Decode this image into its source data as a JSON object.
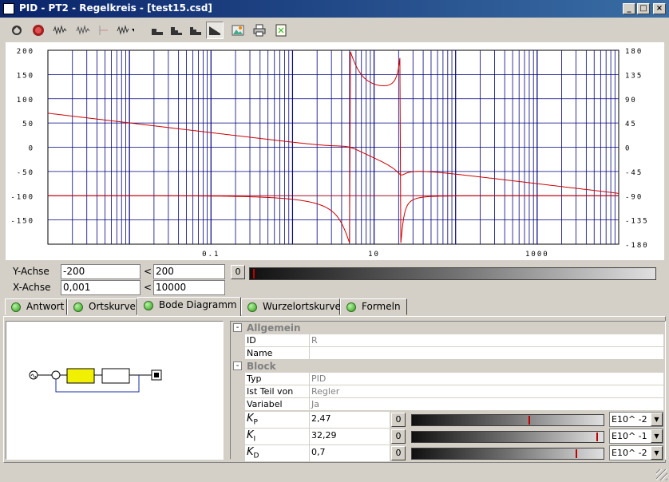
{
  "window": {
    "title": "PID - PT2 - Regelkreis - [test15.csd]",
    "min": "_",
    "max": "□",
    "close": "×"
  },
  "toolbar": {
    "icons": [
      "refresh-icon",
      "stop-icon",
      "noise-icon",
      "noise-plus-icon",
      "marker-icon",
      "noise-dropdown-icon",
      "step-response-icon",
      "step-response-2-icon",
      "step-response-3-icon",
      "bode-icon",
      "image-icon",
      "print-icon",
      "export-icon"
    ],
    "active": "bode-icon"
  },
  "plot": {
    "left_ticks": [
      "200",
      "150",
      "100",
      "50",
      "0",
      "-50",
      "-100",
      "-150"
    ],
    "right_ticks": [
      "180",
      "135",
      "90",
      "45",
      "0",
      "-45",
      "-90",
      "-135",
      "-180"
    ],
    "x_ticks": [
      "0.1",
      "10",
      "1000"
    ],
    "colors": {
      "curve": "#cc0000",
      "grid": "#000080"
    }
  },
  "axes": {
    "y_label": "Y-Achse",
    "y_min": "-200",
    "y_lt": "<",
    "y_max": "200",
    "x_label": "X-Achse",
    "x_min": "0,001",
    "x_lt": "<",
    "x_max": "10000",
    "zoom_btn": "0"
  },
  "tabs": [
    {
      "label": "Antwort"
    },
    {
      "label": "Ortskurve"
    },
    {
      "label": "Bode Diagramm"
    },
    {
      "label": "Wurzelortskurve"
    },
    {
      "label": "Formeln"
    }
  ],
  "props": {
    "general": {
      "header": "Allgemein",
      "pm": "-",
      "id_label": "ID",
      "id_value": "R",
      "name_label": "Name",
      "name_value": ""
    },
    "block": {
      "header": "Block",
      "pm": "-",
      "typ_label": "Typ",
      "typ_value": "PID",
      "teil_label": "Ist Teil von",
      "teil_value": "Regler",
      "var_label": "Variabel",
      "var_value": "Ja"
    },
    "kp": {
      "sym": "K",
      "sub": "P",
      "value": "2,47",
      "btn": "0",
      "scale": "E10^ -2",
      "level": 0.62
    },
    "ki": {
      "sym": "K",
      "sub": "I",
      "value": "32,29",
      "btn": "0",
      "scale": "E10^ -1",
      "level": 0.98
    },
    "kd": {
      "sym": "K",
      "sub": "D",
      "value": "0,7",
      "btn": "0",
      "scale": "E10^ -2",
      "level": 0.87
    }
  }
}
